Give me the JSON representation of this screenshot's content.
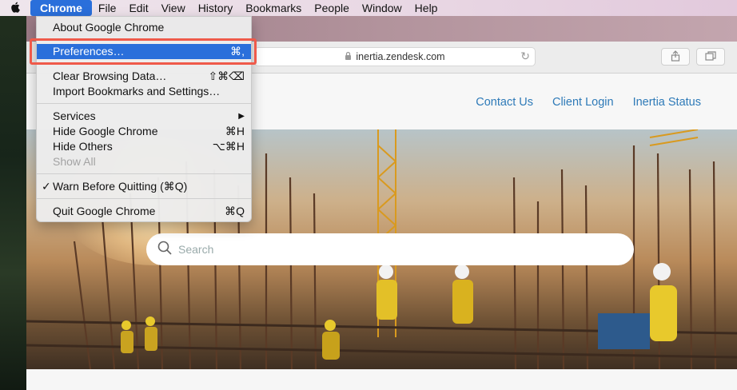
{
  "menubar": {
    "app": "Chrome",
    "items": [
      "File",
      "Edit",
      "View",
      "History",
      "Bookmarks",
      "People",
      "Window",
      "Help"
    ]
  },
  "menu": {
    "about": "About Google Chrome",
    "preferences": {
      "label": "Preferences…",
      "shortcut": "⌘,"
    },
    "clear": {
      "label": "Clear Browsing Data…",
      "shortcut": "⇧⌘⌫"
    },
    "import": "Import Bookmarks and Settings…",
    "services": {
      "label": "Services",
      "shortcut": "▶"
    },
    "hide": {
      "label": "Hide Google Chrome",
      "shortcut": "⌘H"
    },
    "hide_others": {
      "label": "Hide Others",
      "shortcut": "⌥⌘H"
    },
    "show_all": "Show All",
    "warn": {
      "check": "✓",
      "label": "Warn Before Quitting (⌘Q)"
    },
    "quit": {
      "label": "Quit Google Chrome",
      "shortcut": "⌘Q"
    }
  },
  "browser": {
    "url": "inertia.zendesk.com"
  },
  "site": {
    "nav": [
      "Contact Us",
      "Client Login",
      "Inertia Status"
    ],
    "search_placeholder": "Search"
  },
  "icons": {
    "apple": "apple-logo-icon",
    "lock": "lock-icon",
    "reload": "reload-icon",
    "share": "share-icon",
    "tabs": "tabs-overview-icon",
    "search": "search-icon",
    "submenu": "submenu-arrow-icon"
  }
}
